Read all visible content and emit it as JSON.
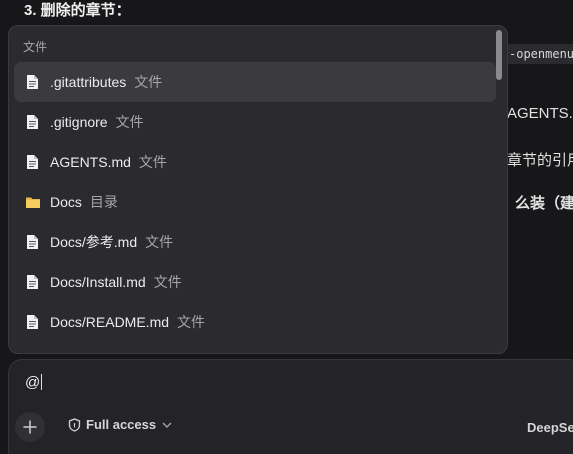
{
  "background": {
    "heading": "3. 删除的章节：",
    "code_fragment": "-openmenu",
    "text_agents": "AGENTS.m",
    "text_refs": "章节的引用",
    "text_install": "么装（建议"
  },
  "popup": {
    "header": "文件",
    "items": [
      {
        "name": ".gitattributes",
        "kind": "文件",
        "icon": "file-icon"
      },
      {
        "name": ".gitignore",
        "kind": "文件",
        "icon": "file-icon"
      },
      {
        "name": "AGENTS.md",
        "kind": "文件",
        "icon": "file-icon"
      },
      {
        "name": "Docs",
        "kind": "目录",
        "icon": "folder-icon"
      },
      {
        "name": "Docs/参考.md",
        "kind": "文件",
        "icon": "file-icon"
      },
      {
        "name": "Docs/Install.md",
        "kind": "文件",
        "icon": "file-icon"
      },
      {
        "name": "Docs/README.md",
        "kind": "文件",
        "icon": "file-icon"
      }
    ],
    "selected_index": 0
  },
  "composer": {
    "input_value": "@",
    "access_label": "Full access",
    "model_label": "DeepSee"
  },
  "colors": {
    "background": "#17171a",
    "popup": "#2b2b2f",
    "selected": "#3a3a3f",
    "folder": "#e8b84a"
  }
}
